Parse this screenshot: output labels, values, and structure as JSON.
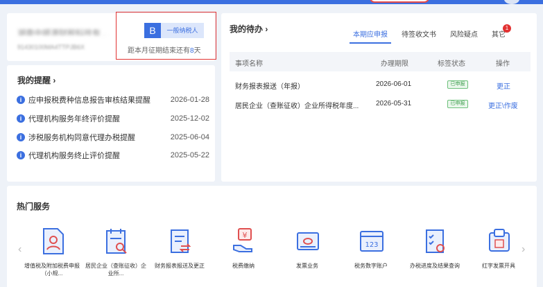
{
  "company": {
    "name": "湖南中顺源财税科技有...",
    "tax_id": "91430100MA4TTPJB6X",
    "taxpayer_badge": "B",
    "taxpayer_type": "一般纳税人",
    "deadline_prefix": "距本月征期结束还有",
    "deadline_days": "8",
    "deadline_suffix": "天"
  },
  "reminders": {
    "title": "我的提醒 ›",
    "items": [
      {
        "label": "应申报税费种信息报告审核结果提醒",
        "date": "2026-01-28"
      },
      {
        "label": "代理机构服务年终评价提醒",
        "date": "2025-12-02"
      },
      {
        "label": "涉税服务机构同意代理办税提醒",
        "date": "2025-06-04"
      },
      {
        "label": "代理机构服务终止评价提醒",
        "date": "2025-05-22"
      }
    ]
  },
  "todo": {
    "title": "我的待办 ›",
    "tabs": [
      "本期应申报",
      "待签收文书",
      "风险疑点",
      "其它"
    ],
    "other_badge": "1",
    "columns": [
      "事项名称",
      "办理期限",
      "标签状态",
      "操作"
    ],
    "rows": [
      {
        "name": "财务报表报送（年报）",
        "deadline": "2026-06-01",
        "status": "已申报",
        "action": "更正"
      },
      {
        "name": "居民企业（查账征收）企业所得税年度...",
        "deadline": "2026-05-31",
        "status": "已申报",
        "action": "更正\\作废"
      }
    ]
  },
  "services": {
    "title": "热门服务",
    "prev_arrow": "‹",
    "next_arrow": "›",
    "items": [
      {
        "label": "增值税及附加税费申报（小规...",
        "icon": "person-document-icon"
      },
      {
        "label": "居民企业（查账征收）企业所...",
        "icon": "calendar-search-icon"
      },
      {
        "label": "财务报表报送及更正",
        "icon": "report-swap-icon"
      },
      {
        "label": "税费缴纳",
        "icon": "hand-yuan-icon"
      },
      {
        "label": "发票业务",
        "icon": "invoice-icon"
      },
      {
        "label": "税务数字账户",
        "icon": "digital-account-icon"
      },
      {
        "label": "办税进度及结果查询",
        "icon": "progress-query-icon"
      },
      {
        "label": "红字发票开具",
        "icon": "red-invoice-icon"
      }
    ]
  },
  "colors": {
    "accent": "#3b6fe0",
    "alert": "#e23232",
    "success": "#3c9c4c"
  }
}
